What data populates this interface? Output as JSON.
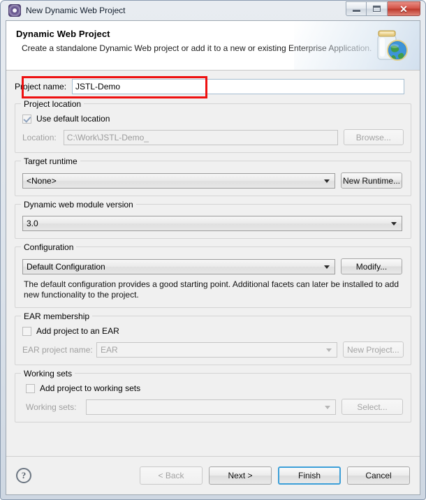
{
  "window": {
    "title": "New Dynamic Web Project",
    "icon": "wizard-gear-icon",
    "controls": {
      "minimize": "minimize-icon",
      "maximize": "maximize-icon",
      "close": "✕"
    }
  },
  "banner": {
    "title": "Dynamic Web Project",
    "subtitle": "Create a standalone Dynamic Web project or add it to a new or existing Enterprise Application.",
    "icon": "jar-globe-icon"
  },
  "project_name": {
    "label": "Project name:",
    "value": "JSTL-Demo",
    "placeholder": "",
    "highlight_color": "#ee1111"
  },
  "project_location": {
    "group_label": "Project location",
    "use_default_label": "Use default location",
    "use_default_checked": true,
    "use_default_enabled": false,
    "location_label": "Location:",
    "location_value": "C:\\Work\\JSTL-Demo_",
    "browse_label": "Browse..."
  },
  "target_runtime": {
    "group_label": "Target runtime",
    "value": "<None>",
    "button_label": "New Runtime..."
  },
  "module_version": {
    "group_label": "Dynamic web module version",
    "value": "3.0"
  },
  "configuration": {
    "group_label": "Configuration",
    "value": "Default Configuration",
    "button_label": "Modify...",
    "description": "The default configuration provides a good starting point. Additional facets can later be installed to add new functionality to the project."
  },
  "ear_membership": {
    "group_label": "EAR membership",
    "add_label": "Add project to an EAR",
    "add_checked": false,
    "project_name_label": "EAR project name:",
    "project_name_value": "EAR",
    "button_label": "New Project..."
  },
  "working_sets": {
    "group_label": "Working sets",
    "add_label": "Add project to working sets",
    "add_checked": false,
    "sets_label": "Working sets:",
    "sets_value": "",
    "button_label": "Select..."
  },
  "buttonbar": {
    "help": "?",
    "back": "< Back",
    "next": "Next >",
    "finish": "Finish",
    "cancel": "Cancel"
  }
}
